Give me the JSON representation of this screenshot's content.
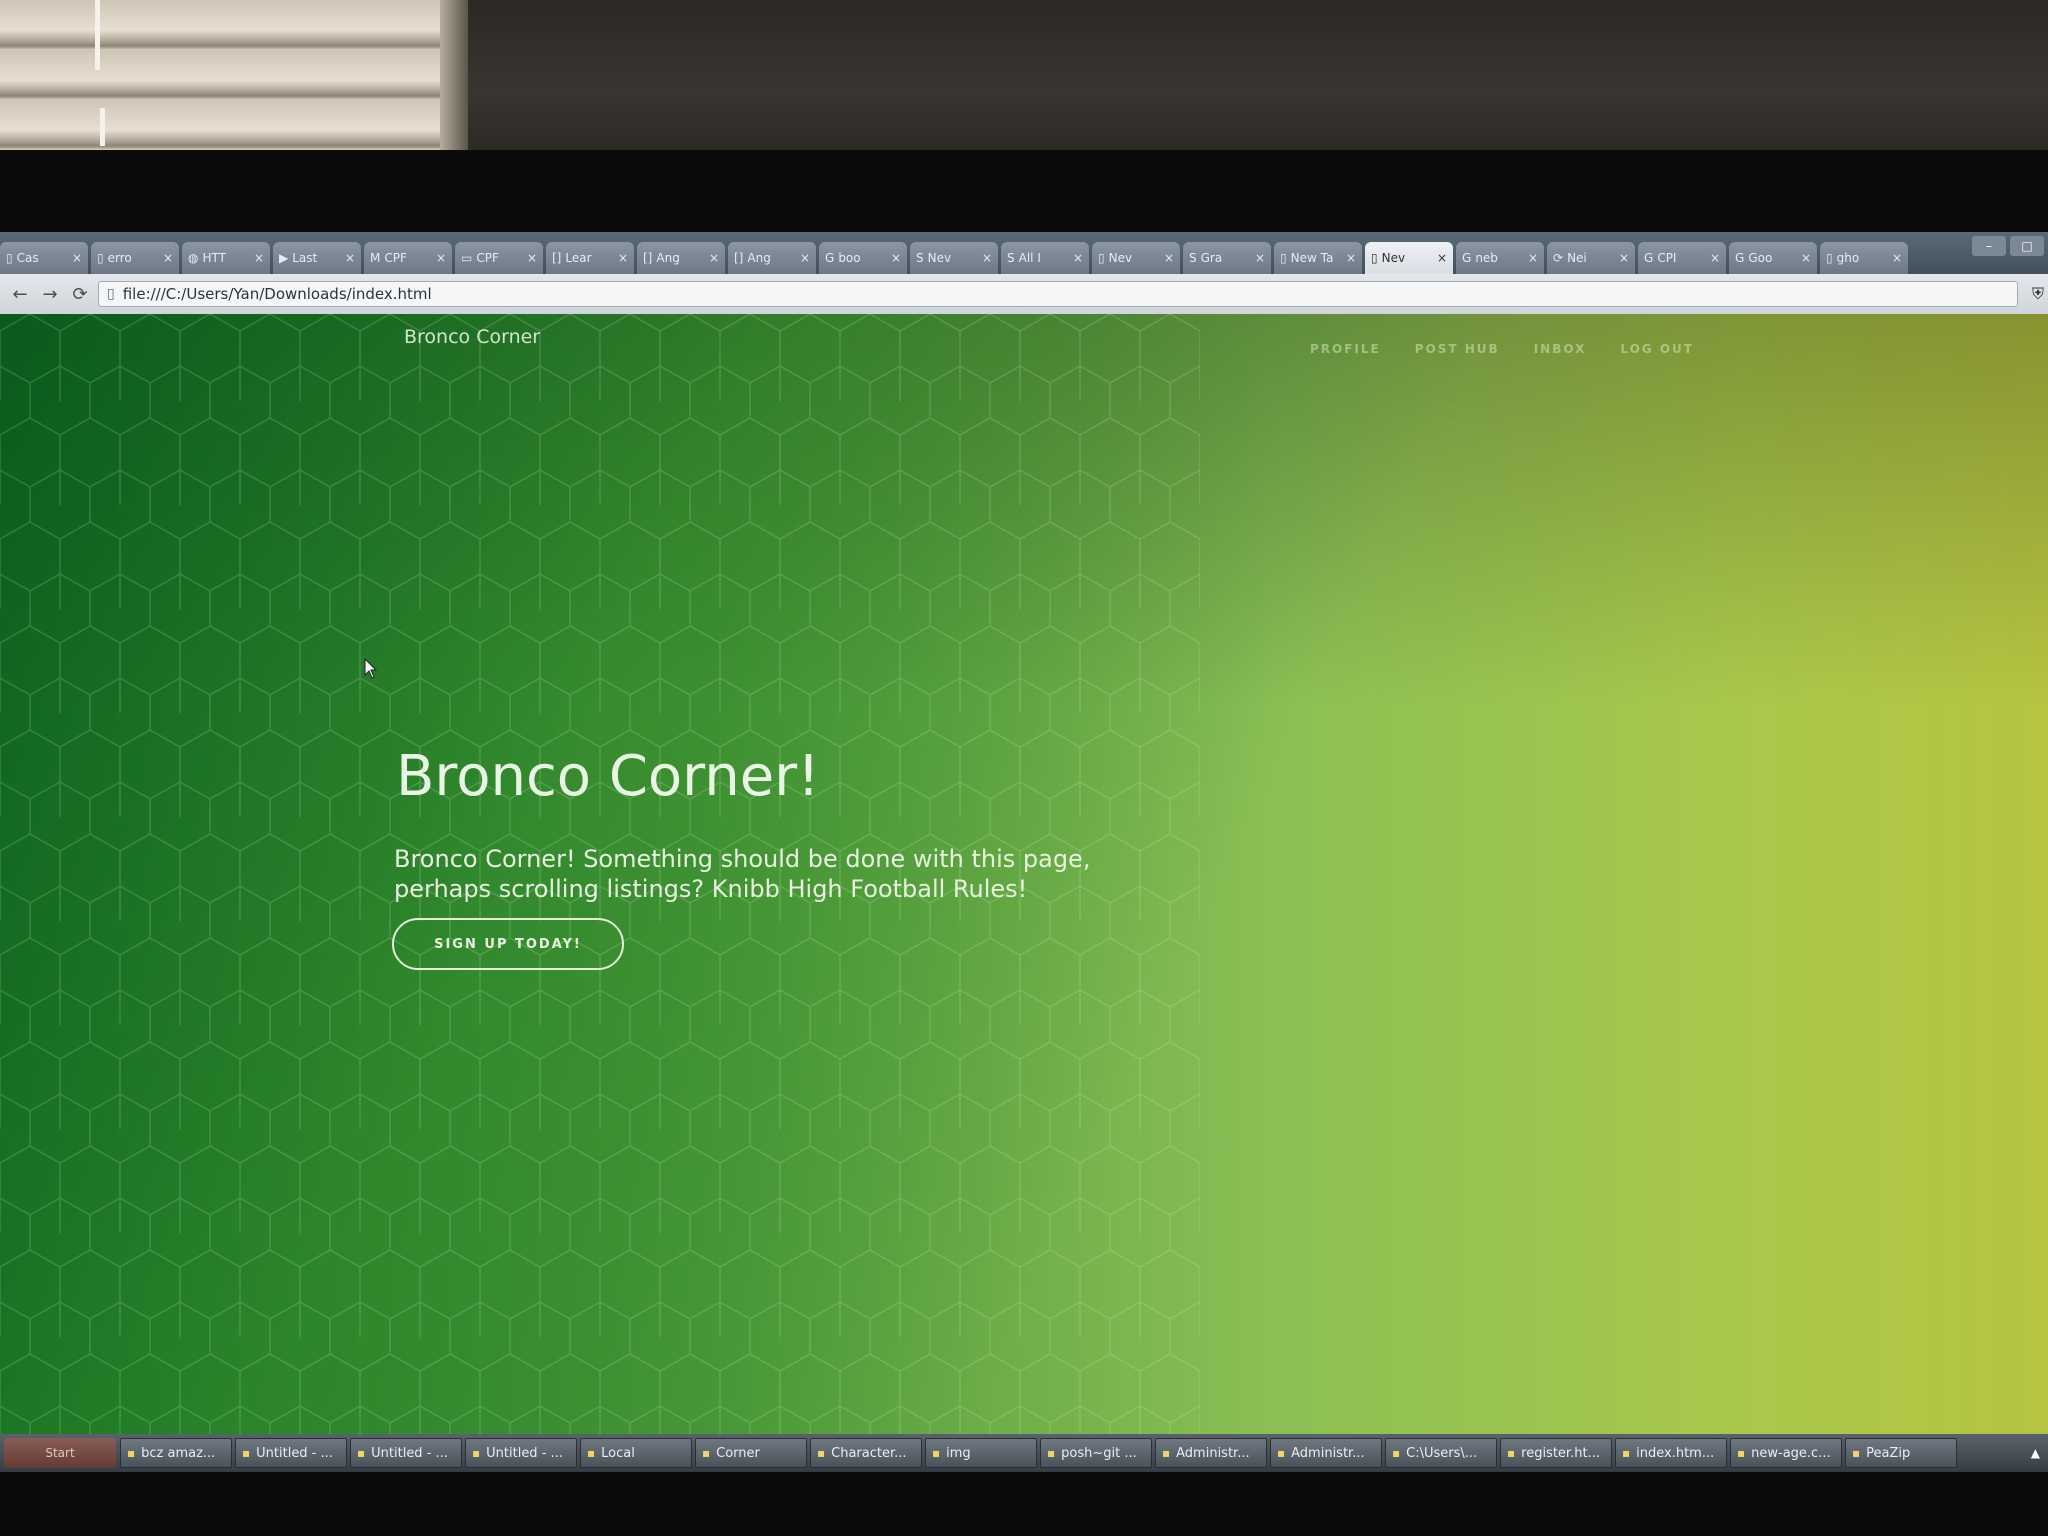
{
  "browser": {
    "tabs": [
      {
        "icon": "page-icon",
        "title": "Cas",
        "active": false
      },
      {
        "icon": "page-icon",
        "title": "erro",
        "active": false
      },
      {
        "icon": "app-icon",
        "title": "HTT",
        "active": false
      },
      {
        "icon": "youtube-icon",
        "title": "Last",
        "active": false
      },
      {
        "icon": "gmail-icon",
        "title": "CPF",
        "active": false
      },
      {
        "icon": "folder-icon",
        "title": "CPF",
        "active": false
      },
      {
        "icon": "bracket-icon",
        "title": "Lear",
        "active": false
      },
      {
        "icon": "bracket-icon",
        "title": "Ang",
        "active": false
      },
      {
        "icon": "bracket-icon",
        "title": "Ang",
        "active": false
      },
      {
        "icon": "google-icon",
        "title": "boo",
        "active": false
      },
      {
        "icon": "s-icon",
        "title": "Nev",
        "active": false
      },
      {
        "icon": "s-icon",
        "title": "All I",
        "active": false
      },
      {
        "icon": "page-icon",
        "title": "Nev",
        "active": false
      },
      {
        "icon": "s-icon",
        "title": "Gra",
        "active": false
      },
      {
        "icon": "page-icon",
        "title": "New Ta",
        "active": false
      },
      {
        "icon": "page-icon",
        "title": "Nev",
        "active": true
      },
      {
        "icon": "google-icon",
        "title": "neb",
        "active": false
      },
      {
        "icon": "reload-icon",
        "title": "Nei",
        "active": false
      },
      {
        "icon": "google-icon",
        "title": "CPI",
        "active": false
      },
      {
        "icon": "google-icon",
        "title": "Goo",
        "active": false
      },
      {
        "icon": "page-icon",
        "title": "gho",
        "active": false
      }
    ],
    "address": "file:///C:/Users/Yan/Downloads/index.html"
  },
  "page": {
    "brand": "Bronco Corner",
    "nav_links": [
      "PROFILE",
      "POST HUB",
      "INBOX",
      "LOG OUT"
    ],
    "hero_title": "Bronco Corner!",
    "hero_text": "Bronco Corner! Something should be done with this page, perhaps scrolling listings? Knibb High Football Rules!",
    "cta_label": "SIGN UP TODAY!"
  },
  "taskbar": {
    "start_label": "Start",
    "items": [
      {
        "label": "bcz amaz..."
      },
      {
        "label": "Untitled - ..."
      },
      {
        "label": "Untitled - ..."
      },
      {
        "label": "Untitled - ..."
      },
      {
        "label": "Local"
      },
      {
        "label": "Corner"
      },
      {
        "label": "Character..."
      },
      {
        "label": "img"
      },
      {
        "label": "posh~git ..."
      },
      {
        "label": "Administr..."
      },
      {
        "label": "Administr..."
      },
      {
        "label": "C:\\Users\\..."
      },
      {
        "label": "register.ht..."
      },
      {
        "label": "index.htm..."
      },
      {
        "label": "new-age.c..."
      },
      {
        "label": "PeaZip"
      }
    ]
  },
  "colors": {
    "page_green_dark": "#1d7d28",
    "page_green_light": "#b6c441",
    "hero_text": "#e9f5e4"
  }
}
